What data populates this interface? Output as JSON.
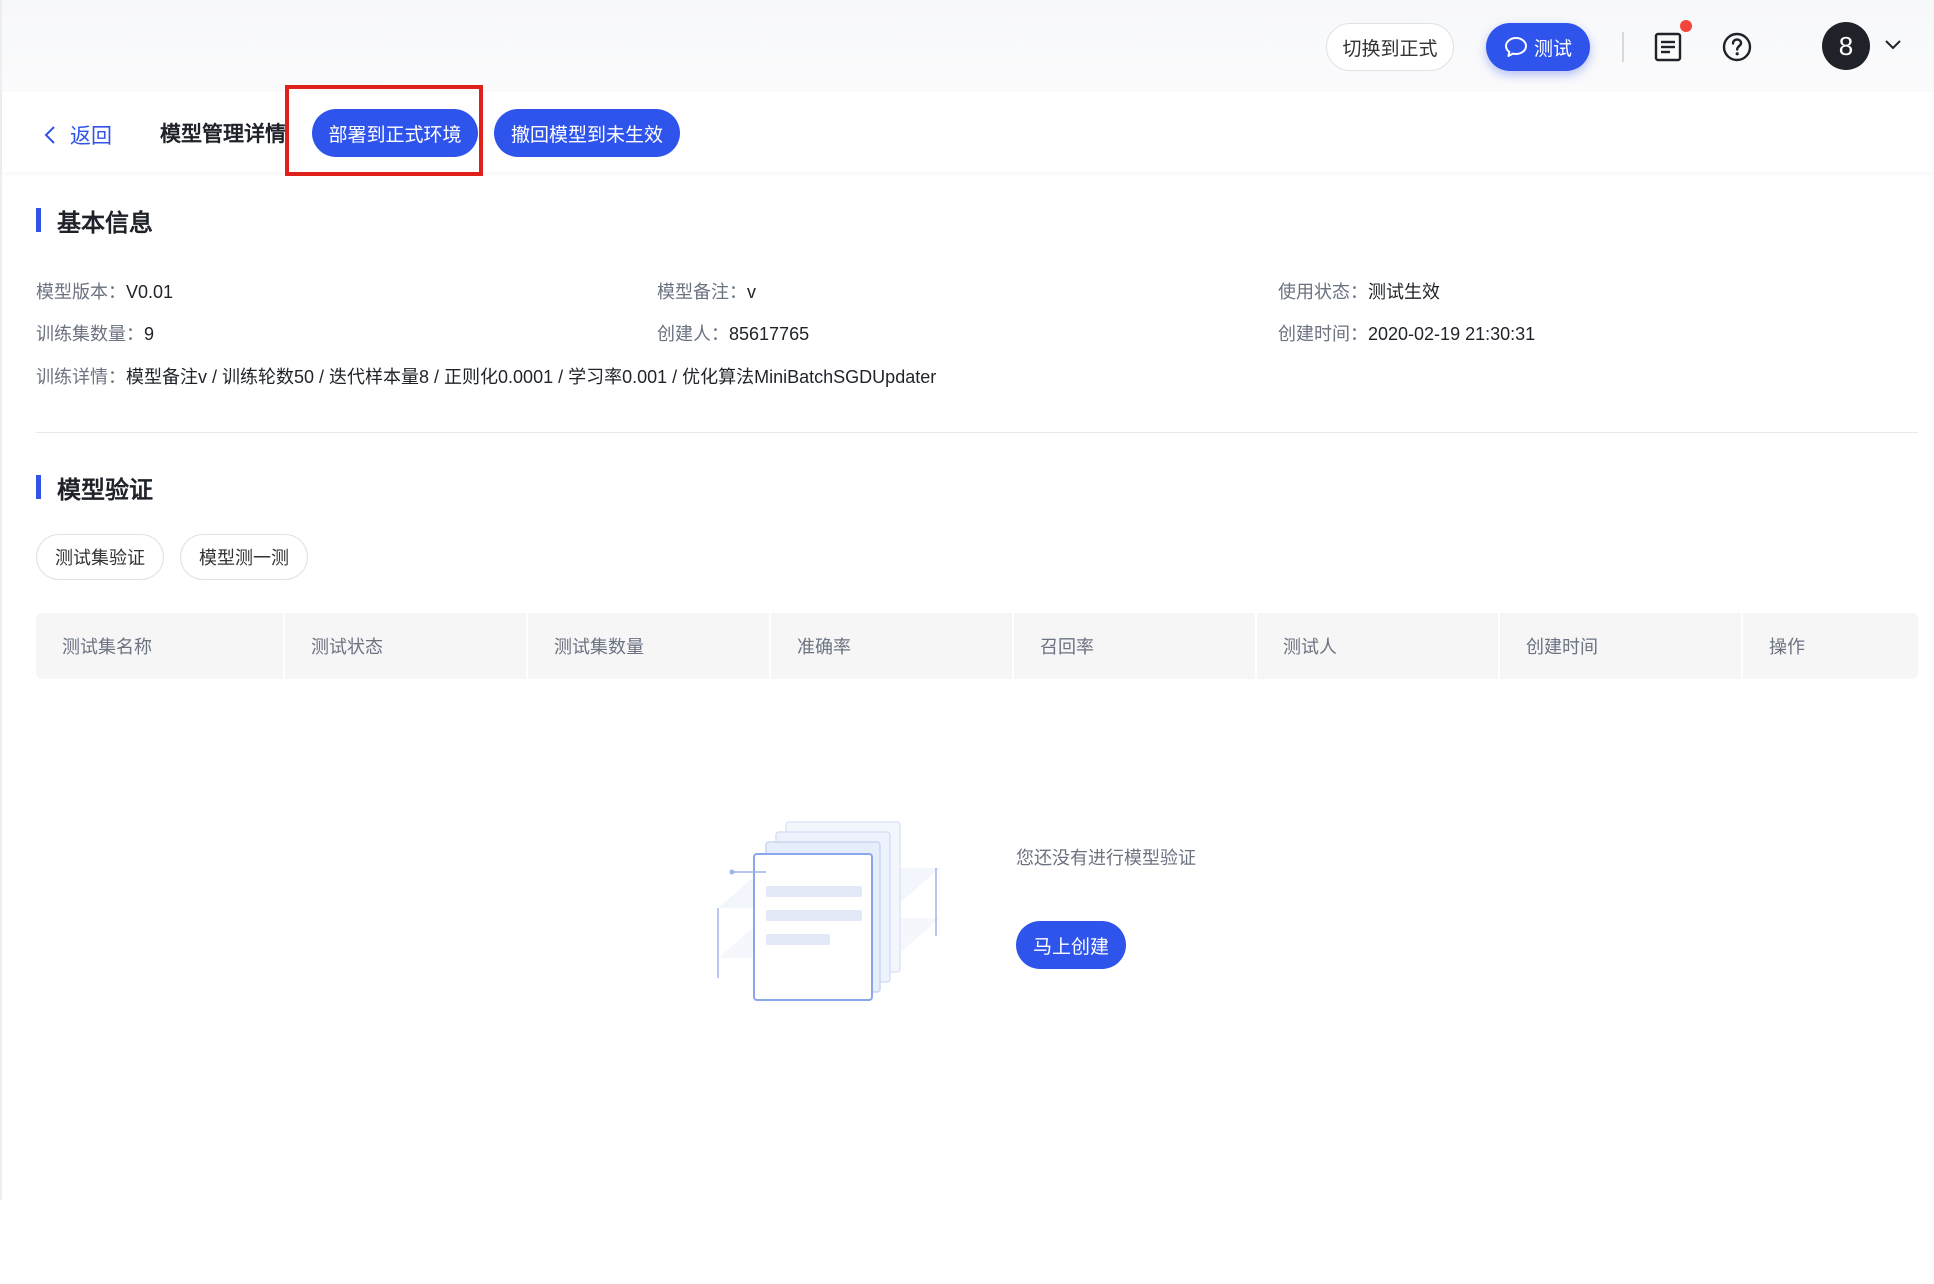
{
  "header": {
    "switch_label": "切换到正式",
    "test_label": "测试",
    "avatar_initial": "8"
  },
  "subheader": {
    "back_label": "返回",
    "page_title": "模型管理详情",
    "deploy_label": "部署到正式环境",
    "revoke_label": "撤回模型到未生效"
  },
  "basic_info": {
    "title": "基本信息",
    "version_label": "模型版本：",
    "version_value": "V0.01",
    "remark_label": "模型备注：",
    "remark_value": "v",
    "status_label": "使用状态：",
    "status_value": "测试生效",
    "train_count_label": "训练集数量：",
    "train_count_value": "9",
    "creator_label": "创建人：",
    "creator_value": "85617765",
    "created_time_label": "创建时间：",
    "created_time_value": "2020-02-19 21:30:31",
    "train_detail_label": "训练详情：",
    "train_detail_value": "模型备注v / 训练轮数50 / 迭代样本量8 / 正则化0.0001 / 学习率0.001 / 优化算法MiniBatchSGDUpdater"
  },
  "verification": {
    "title": "模型验证",
    "testset_button": "测试集验证",
    "try_button": "模型测一测",
    "columns": [
      "测试集名称",
      "测试状态",
      "测试集数量",
      "准确率",
      "召回率",
      "测试人",
      "创建时间",
      "操作"
    ],
    "empty_text": "您还没有进行模型验证",
    "create_button": "马上创建"
  },
  "colors": {
    "primary": "#2f54eb",
    "highlight": "#e0201b",
    "notification": "#f5443b"
  },
  "icons": {
    "test": "chat-bubble-icon",
    "doc": "document-list-icon",
    "help": "question-circle-icon",
    "back": "chevron-left-icon",
    "menu": "chevron-down-icon"
  }
}
